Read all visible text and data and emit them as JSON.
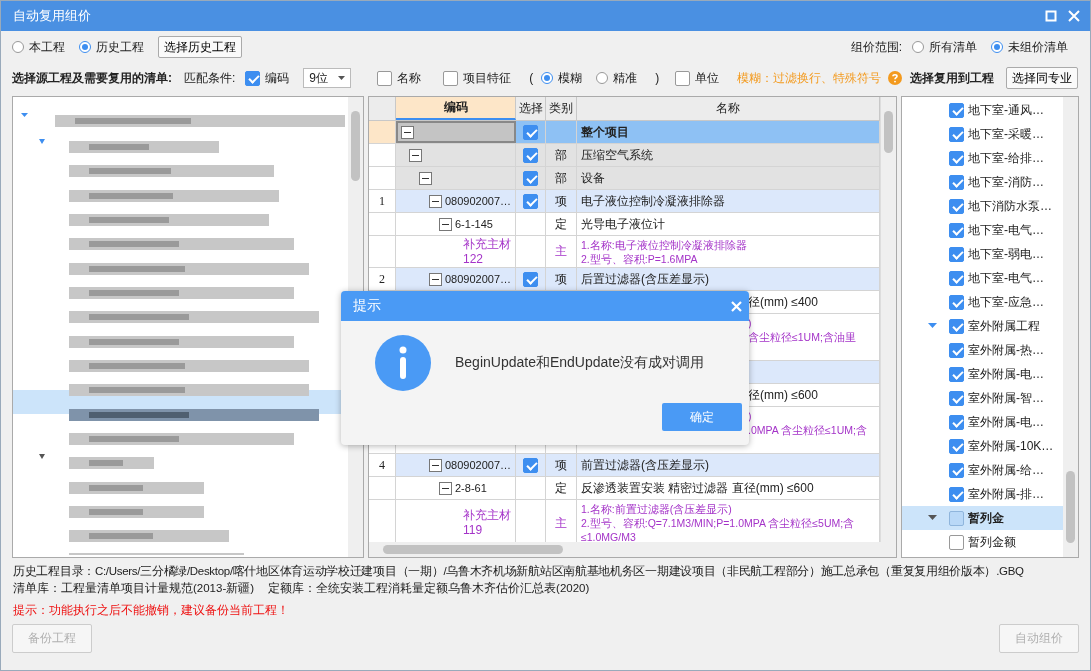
{
  "window": {
    "title": "自动复用组价"
  },
  "source": {
    "options": [
      {
        "label": "本工程",
        "selected": false
      },
      {
        "label": "历史工程",
        "selected": true
      }
    ],
    "button": "选择历史工程"
  },
  "scope": {
    "label": "组价范围:",
    "options": [
      {
        "label": "所有清单",
        "selected": false
      },
      {
        "label": "未组价清单",
        "selected": true
      }
    ]
  },
  "match": {
    "heading": "选择源工程及需要复用的清单:",
    "label": "匹配条件:",
    "code": {
      "label": "编码",
      "checked": true
    },
    "digits": "9位",
    "name": {
      "label": "名称",
      "checked": false
    },
    "feature": {
      "label": "项目特征",
      "checked": false
    },
    "open_paren": "(",
    "modes": [
      {
        "label": "模糊",
        "selected": true
      },
      {
        "label": "精准",
        "selected": false
      }
    ],
    "close_paren": ")",
    "unit": {
      "label": "单位",
      "checked": false
    },
    "hint": "模糊：过滤换行、特殊符号"
  },
  "target": {
    "heading": "选择复用到工程",
    "button": "选择同专业"
  },
  "source_tree": {
    "kind": "blurred"
  },
  "grid": {
    "columns": [
      {
        "label": "编码",
        "selected": true
      },
      {
        "label": "选择",
        "selected": false
      },
      {
        "label": "类别",
        "selected": false
      },
      {
        "label": "名称",
        "selected": false
      }
    ],
    "rows": [
      {
        "kind": "root",
        "selected": true,
        "checked": true,
        "name": "整个项目",
        "children": [
          {
            "kind": "section",
            "checked": true,
            "type": "部",
            "name": "压缩空气系统",
            "children": [
              {
                "kind": "section",
                "checked": true,
                "type": "部",
                "name": "设备",
                "children": [
                  {
                    "kind": "item",
                    "no": "1",
                    "code": "080902007…",
                    "checked": true,
                    "type": "项",
                    "name": "电子液位控制冷凝液排除器",
                    "children": [
                      {
                        "kind": "quota",
                        "code": "6-1-145",
                        "type": "定",
                        "name": "光导电子液位计",
                        "children": [
                          {
                            "kind": "material",
                            "code": "补充主材122",
                            "type": "主",
                            "lines": [
                              {
                                "text": "1.名称:电子液位控制冷凝液排除器",
                                "covered": false
                              },
                              {
                                "text": "2.型号、容积:P=1.6MPA",
                                "covered": false
                              }
                            ]
                          }
                        ]
                      }
                    ]
                  },
                  {
                    "kind": "item",
                    "no": "2",
                    "code": "080902007…",
                    "checked": true,
                    "type": "项",
                    "name": "后置过滤器(含压差显示)",
                    "children": [
                      {
                        "kind": "quota",
                        "covered": true,
                        "name": "径(mm) ≤400",
                        "children": [
                          {
                            "kind": "material",
                            "covered": true,
                            "lines": [
                              {
                                "text": ")",
                                "covered": true
                              },
                              {
                                "text": "含尘粒径≤1UM;含油里",
                                "covered": true
                              }
                            ]
                          }
                        ]
                      }
                    ]
                  },
                  {
                    "kind": "item",
                    "covered": true,
                    "children": [
                      {
                        "kind": "quota",
                        "covered": true,
                        "name": "径(mm) ≤600",
                        "children": [
                          {
                            "kind": "material",
                            "covered": true,
                            "lines": [
                              {
                                "text": ")",
                                "covered": true
                              },
                              {
                                "text": ".0MPA 含尘粒径≤1UM;含",
                                "covered": true
                              }
                            ]
                          }
                        ]
                      }
                    ]
                  },
                  {
                    "kind": "item",
                    "no": "4",
                    "code": "080902007…",
                    "checked": true,
                    "type": "项",
                    "name": "前置过滤器(含压差显示)",
                    "children": [
                      {
                        "kind": "quota",
                        "code": "2-8-61",
                        "type": "定",
                        "name": "反渗透装置安装 精密过滤器 直径(mm) ≤600",
                        "children": [
                          {
                            "kind": "material",
                            "code": "补充主材119",
                            "type": "主",
                            "lines": [
                              {
                                "text": "1.名称:前置过滤器(含压差显示)",
                                "covered": false
                              },
                              {
                                "text": "2.型号、容积:Q=7.1M3/MIN;P=1.0MPA 含尘粒径≤5UM;含",
                                "covered": false
                              },
                              {
                                "text": "≤1.0MG/M3",
                                "covered": false
                              }
                            ]
                          }
                        ]
                      }
                    ]
                  }
                ]
              }
            ]
          }
        ]
      }
    ]
  },
  "target_tree": [
    {
      "label": "地下室-通风…",
      "checked": true,
      "selected": false
    },
    {
      "label": "地下室-采暖…",
      "checked": true,
      "selected": false
    },
    {
      "label": "地下室-给排…",
      "checked": true,
      "selected": false
    },
    {
      "label": "地下室-消防…",
      "checked": true,
      "selected": false
    },
    {
      "label": "地下消防水泵…",
      "checked": true,
      "selected": false
    },
    {
      "label": "地下室-电气…",
      "checked": true,
      "selected": false
    },
    {
      "label": "地下室-弱电…",
      "checked": true,
      "selected": false
    },
    {
      "label": "地下室-电气…",
      "checked": true,
      "selected": false
    },
    {
      "label": "地下室-应急…",
      "checked": true,
      "selected": false
    },
    {
      "label": "室外附属工程",
      "checked": true,
      "selected": false,
      "expanded": true,
      "children": [
        {
          "label": "室外附属-热…",
          "checked": true,
          "selected": false
        },
        {
          "label": "室外附属-电…",
          "checked": true,
          "selected": false
        },
        {
          "label": "室外附属-智…",
          "checked": true,
          "selected": false
        },
        {
          "label": "室外附属-电…",
          "checked": true,
          "selected": false
        },
        {
          "label": "室外附属-10K…",
          "checked": true,
          "selected": false
        },
        {
          "label": "室外附属-给…",
          "checked": true,
          "selected": false
        },
        {
          "label": "室外附属-排…",
          "checked": true,
          "selected": false
        }
      ]
    },
    {
      "label": "暂列金",
      "checked": false,
      "selected": true,
      "expanded": true,
      "children": [
        {
          "label": "暂列金额",
          "checked": false,
          "selected": false
        }
      ]
    }
  ],
  "info": {
    "path": "历史工程目录：C:/Users/三分橘绿/Desktop/喀什地区体育运动学校迁建项目（一期）/乌鲁木齐机场新航站区南航基地机务区一期建设项目（非民航工程部分）施工总承包（重复复用组价版本）.GBQ",
    "list_lib": "清单库：工程量清单项目计量规范(2013-新疆)",
    "quota_lib": "定额库：全统安装工程消耗量定额乌鲁木齐估价汇总表(2020)",
    "warning": "提示：功能执行之后不能撤销，建议备份当前工程！"
  },
  "footer": {
    "backup": {
      "label": "备份工程",
      "disabled": true
    },
    "auto": {
      "label": "自动组价",
      "disabled": true
    }
  },
  "dialog": {
    "title": "提示",
    "message": "BeginUpdate和EndUpdate没有成对调用",
    "button": "确定"
  }
}
